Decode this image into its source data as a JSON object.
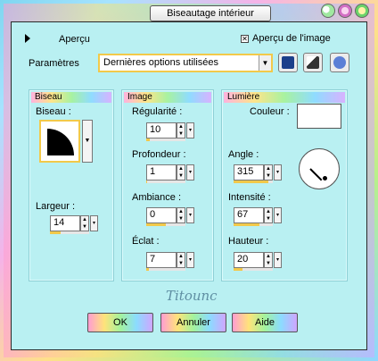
{
  "window": {
    "title": "Biseautage intérieur"
  },
  "preview": {
    "label": "Aperçu",
    "checkbox_label": "Aperçu de l'image",
    "checked": true
  },
  "params": {
    "label": "Paramètres",
    "selected": "Dernières options utilisées"
  },
  "toolbar_icons": [
    "save-icon",
    "preset-icon",
    "reset-icon"
  ],
  "biseau": {
    "title": "Biseau",
    "shape_label": "Biseau :",
    "width_label": "Largeur :",
    "width_value": "14",
    "width_level": 0.28
  },
  "image": {
    "title": "Image",
    "regularite_label": "Régularité :",
    "regularite_value": "10",
    "regularite_level": 0.1,
    "profondeur_label": "Profondeur :",
    "profondeur_value": "1",
    "profondeur_level": 0.01,
    "ambiance_label": "Ambiance :",
    "ambiance_value": "0",
    "ambiance_level": 0.5,
    "eclat_label": "Éclat :",
    "eclat_value": "7",
    "eclat_level": 0.07
  },
  "lumiere": {
    "title": "Lumière",
    "couleur_label": "Couleur :",
    "couleur_value": "#ffffff",
    "angle_label": "Angle :",
    "angle_value": "315",
    "angle_level": 0.875,
    "intensite_label": "Intensité :",
    "intensite_value": "67",
    "intensite_level": 0.67,
    "hauteur_label": "Hauteur :",
    "hauteur_value": "20",
    "hauteur_level": 0.22
  },
  "signature": "Titounc",
  "buttons": {
    "ok": "OK",
    "cancel": "Annuler",
    "help": "Aide"
  },
  "colors": {
    "accent": "#f2c94a",
    "panel_bg": "#b9f0f2"
  }
}
